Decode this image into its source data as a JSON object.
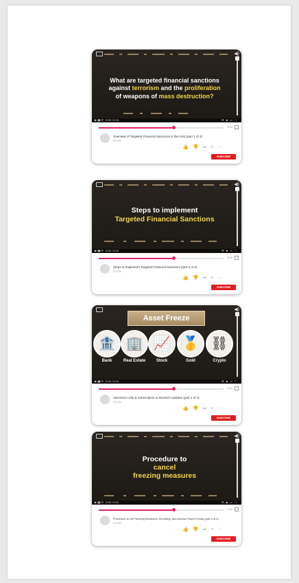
{
  "cards": [
    {
      "title_parts": [
        {
          "text": "What are targeted financial sanctions",
          "hl": false,
          "br": true
        },
        {
          "text": "against ",
          "hl": false
        },
        {
          "text": "terrorism",
          "hl": true
        },
        {
          "text": " and the ",
          "hl": false
        },
        {
          "text": "proliferation",
          "hl": true,
          "br": true
        },
        {
          "text": "of weapons of ",
          "hl": false
        },
        {
          "text": "mass destruction?",
          "hl": true
        }
      ],
      "video_title": "Overview of Targeted Financial Sanctions in the UAE (part 1 of 4)",
      "channel": "EOCN",
      "time": "0:24",
      "subscribe": "SUBSCRIBE",
      "progress": 0.6
    },
    {
      "title_parts": [
        {
          "text": "Steps to implement",
          "hl": false,
          "br": true
        },
        {
          "text": "Targeted Financial Sanctions",
          "hl": true
        }
      ],
      "video_title": "Steps to Implement Targeted Financial Sanctions (part 3 of 4)",
      "channel": "EOCN",
      "time": "0:24",
      "subscribe": "SUBSCRIBE",
      "progress": 0.6
    },
    {
      "banner": "Asset Freeze",
      "assets": [
        {
          "label": "Bank",
          "icon": "bank-icon",
          "glyph": "🏦"
        },
        {
          "label": "Real Estate",
          "icon": "real-estate-icon",
          "glyph": "🏢"
        },
        {
          "label": "Stock",
          "icon": "stock-chart-icon",
          "glyph": "📈"
        },
        {
          "label": "Gold",
          "icon": "gold-bars-icon",
          "glyph": "🥇"
        },
        {
          "label": "Crypto",
          "icon": "crypto-network-icon",
          "glyph": "⛓"
        }
      ],
      "video_title": "Sanctions Lists & Subscription to Receive Updates (part 2 of 4)",
      "channel": "EOCN",
      "time": "0:24",
      "subscribe": "SUBSCRIBE",
      "progress": 0.6
    },
    {
      "title_parts": [
        {
          "text": "Procedure to",
          "hl": false,
          "br": true
        },
        {
          "text": "cancel",
          "hl": true,
          "br": true
        },
        {
          "text": "freezing measures",
          "hl": true
        }
      ],
      "video_title": "Procedure to Lift Freezing Measures, De-listing, and Access Frozen Funds (part 4 of 4)",
      "channel": "EOCN",
      "time": "0:24",
      "subscribe": "SUBSCRIBE",
      "progress": 0.6
    }
  ],
  "colors": {
    "accent": "#e0245e",
    "highlight": "#f2d84a",
    "subscribe": "#e11d1d",
    "video_bg": "#231f1b"
  }
}
